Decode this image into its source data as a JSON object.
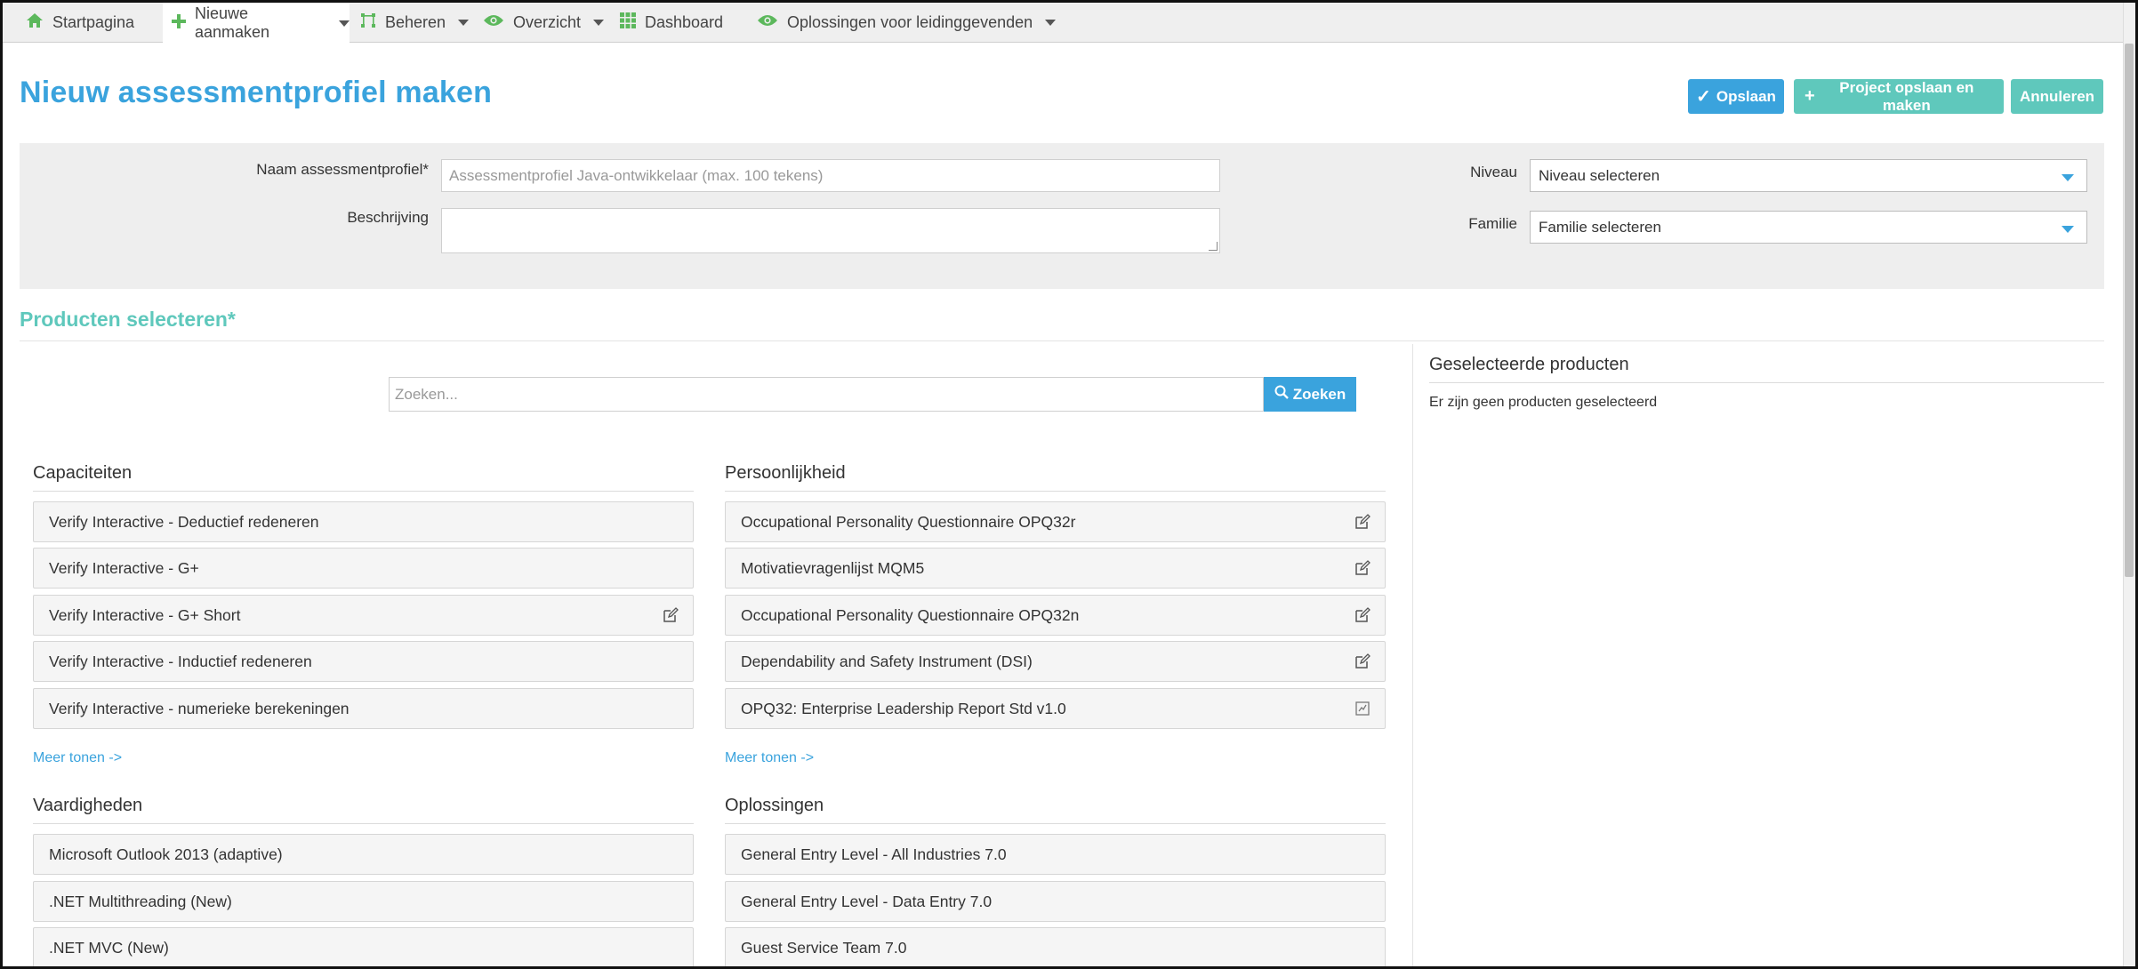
{
  "nav": {
    "items": [
      {
        "label": "Startpagina",
        "icon": "home-icon",
        "dropdown": false
      },
      {
        "label": "Nieuwe aanmaken",
        "icon": "plus-icon",
        "dropdown": true,
        "active": true
      },
      {
        "label": "Beheren",
        "icon": "manage-icon",
        "dropdown": true
      },
      {
        "label": "Overzicht",
        "icon": "eye-icon",
        "dropdown": true
      },
      {
        "label": "Dashboard",
        "icon": "grid-icon",
        "dropdown": false
      },
      {
        "label": "Oplossingen voor leidinggevenden",
        "icon": "eye-icon",
        "dropdown": true
      }
    ]
  },
  "header": {
    "title": "Nieuw assessmentprofiel maken",
    "save_label": "Opslaan",
    "save_project_label": "Project opslaan en maken",
    "cancel_label": "Annuleren"
  },
  "form": {
    "name_label": "Naam assessmentprofiel*",
    "name_placeholder": "Assessmentprofiel Java-ontwikkelaar (max. 100 tekens)",
    "description_label": "Beschrijving",
    "level_label": "Niveau",
    "level_value": "Niveau selecteren",
    "family_label": "Familie",
    "family_value": "Familie selecteren"
  },
  "products": {
    "section_title": "Producten selecteren*",
    "search_placeholder": "Zoeken...",
    "search_button": "Zoeken",
    "selected_title": "Geselecteerde producten",
    "selected_empty": "Er zijn geen producten geselecteerd",
    "categories": {
      "capaciteiten": {
        "title": "Capaciteiten",
        "more": "Meer tonen ->",
        "items": [
          "Verify Interactive - Deductief redeneren",
          "Verify Interactive - G+",
          "Verify Interactive - G+ Short",
          "Verify Interactive - Inductief redeneren",
          "Verify Interactive - numerieke berekeningen"
        ]
      },
      "persoonlijkheid": {
        "title": "Persoonlijkheid",
        "more": "Meer tonen ->",
        "items": [
          "Occupational Personality Questionnaire OPQ32r",
          "Motivatievragenlijst MQM5",
          "Occupational Personality Questionnaire OPQ32n",
          "Dependability and Safety Instrument (DSI)",
          "OPQ32: Enterprise Leadership Report Std v1.0"
        ]
      },
      "vaardigheden": {
        "title": "Vaardigheden",
        "items": [
          "Microsoft Outlook 2013 (adaptive)",
          ".NET Multithreading (New)",
          ".NET MVC (New)"
        ]
      },
      "oplossingen": {
        "title": "Oplossingen",
        "items": [
          "General Entry Level - All Industries 7.0",
          "General Entry Level - Data Entry 7.0",
          "Guest Service Team 7.0"
        ]
      }
    }
  },
  "colors": {
    "primary": "#3aa3dd",
    "accent": "#5fc8bc",
    "nav_icon": "#5cb85c"
  }
}
